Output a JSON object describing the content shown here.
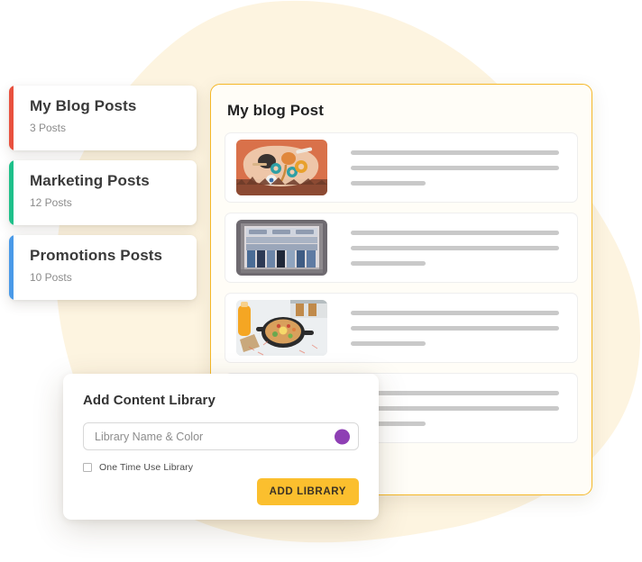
{
  "theme": {
    "blob_color": "#fdf4e0",
    "panel_border": "#f5b828",
    "panel_bg": "#fffdf7",
    "accent_button": "#fbbf2e",
    "swatch_purple": "#8e3fb4",
    "skeleton_gray": "#c9c9c9"
  },
  "sidebar": {
    "items": [
      {
        "title": "My Blog Posts",
        "count": "3 Posts",
        "accent": "#e8513f"
      },
      {
        "title": "Marketing Posts",
        "count": "12 Posts",
        "accent": "#1fc08a"
      },
      {
        "title": "Promotions Posts",
        "count": "10 Posts",
        "accent": "#4a9ae8"
      }
    ]
  },
  "main": {
    "title": "My blog Post",
    "posts": [
      {
        "thumb": "food-flatlay-orange-thumbnail",
        "lines": [
          "full",
          "full",
          "short"
        ]
      },
      {
        "thumb": "denim-store-shelves-thumbnail",
        "lines": [
          "full",
          "full",
          "short"
        ]
      },
      {
        "thumb": "skillet-breakfast-thumbnail",
        "lines": [
          "full",
          "full",
          "short"
        ]
      },
      {
        "thumb": "hidden-thumbnail",
        "lines": [
          "full",
          "full",
          "short"
        ]
      }
    ]
  },
  "modal": {
    "title": "Add Content Library",
    "name_field": {
      "value": "",
      "placeholder": "Library Name & Color"
    },
    "color_swatch": "#8e3fb4",
    "checkbox": {
      "label": "One Time Use Library",
      "checked": false
    },
    "submit_label": "ADD LIBRARY"
  }
}
